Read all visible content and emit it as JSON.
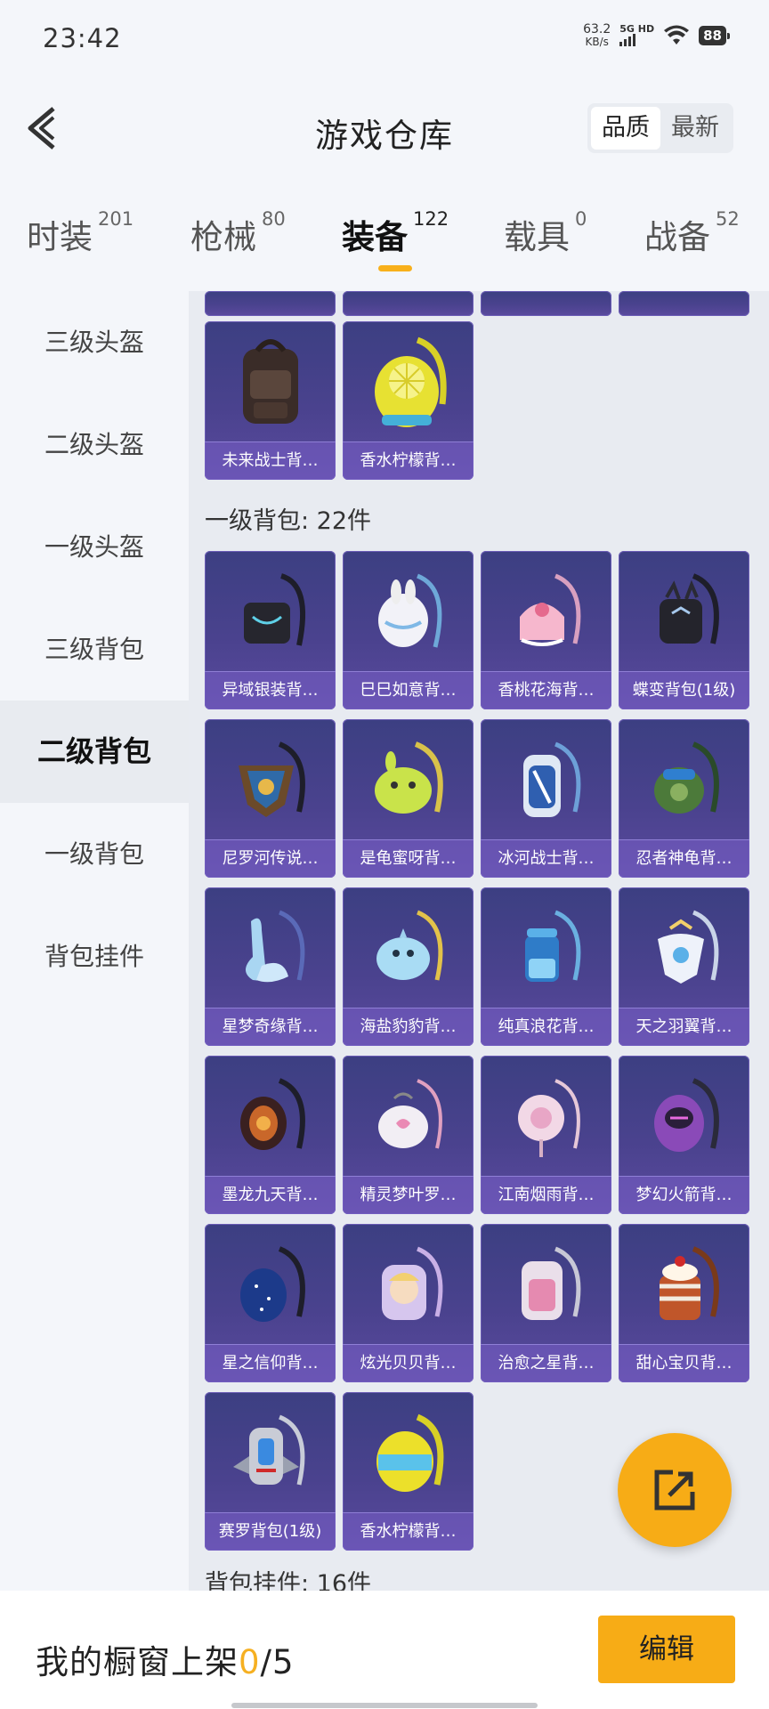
{
  "status": {
    "time": "23:42",
    "net_speed": "63.2",
    "net_unit": "KB/s",
    "net_type": "5G HD",
    "battery": "88"
  },
  "header": {
    "title": "游戏仓库",
    "sort": [
      "品质",
      "最新"
    ]
  },
  "tabs": [
    {
      "label": "时装",
      "count": "201"
    },
    {
      "label": "枪械",
      "count": "80"
    },
    {
      "label": "装备",
      "count": "122"
    },
    {
      "label": "载具",
      "count": "0"
    },
    {
      "label": "战备",
      "count": "52"
    }
  ],
  "sidebar": [
    "三级头盔",
    "二级头盔",
    "一级头盔",
    "三级背包",
    "二级背包",
    "一级背包",
    "背包挂件"
  ],
  "content": {
    "prev_items": [
      "未来战士背…",
      "香水柠檬背…"
    ],
    "section": "一级背包: 22件",
    "items": [
      "异域银装背…",
      "巳巳如意背…",
      "香桃花海背…",
      "蝶变背包(1级)",
      "尼罗河传说…",
      "是龟蜜呀背…",
      "冰河战士背…",
      "忍者神龟背…",
      "星梦奇缘背…",
      "海盐豹豹背…",
      "纯真浪花背…",
      "天之羽翼背…",
      "墨龙九天背…",
      "精灵梦叶罗…",
      "江南烟雨背…",
      "梦幻火箭背…",
      "星之信仰背…",
      "炫光贝贝背…",
      "治愈之星背…",
      "甜心宝贝背…",
      "赛罗背包(1级)",
      "香水柠檬背…"
    ],
    "next_section": "背包挂件: 16件"
  },
  "footer": {
    "label": "我的橱窗上架",
    "count": "0",
    "total": "/5",
    "edit": "编辑"
  },
  "colors": {
    "accent": "#f7ac16",
    "card_bg": "#3c3f82"
  }
}
